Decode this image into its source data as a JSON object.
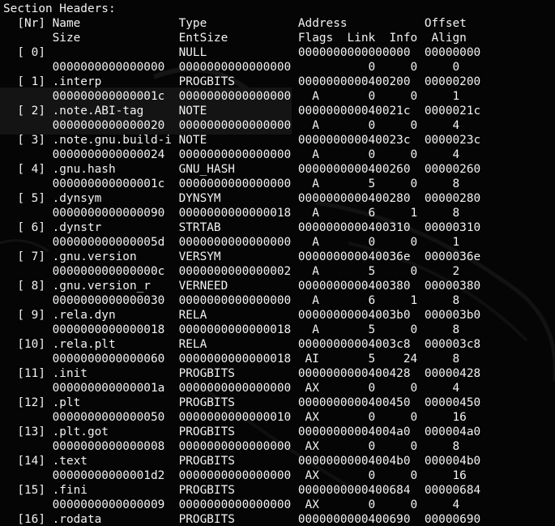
{
  "terminal": {
    "background": "#000000",
    "text_color": "#f2f2f2",
    "header": "Section Headers:",
    "column_headers": [
      "  [Nr] Name              Type             Address           Offset",
      "       Size              EntSize          Flags  Link  Info  Align"
    ],
    "sections": [
      {
        "line1": "  [ 0]                   NULL             0000000000000000  00000000",
        "line2": "       0000000000000000  0000000000000000           0     0     0"
      },
      {
        "line1": "  [ 1] .interp           PROGBITS         0000000000400200  00000200",
        "line2": "       000000000000001c  0000000000000000   A       0     0     1"
      },
      {
        "line1": "  [ 2] .note.ABI-tag     NOTE             000000000040021c  0000021c",
        "line2": "       0000000000000020  0000000000000000   A       0     0     4"
      },
      {
        "line1": "  [ 3] .note.gnu.build-i NOTE             000000000040023c  0000023c",
        "line2": "       0000000000000024  0000000000000000   A       0     0     4"
      },
      {
        "line1": "  [ 4] .gnu.hash         GNU_HASH         0000000000400260  00000260",
        "line2": "       000000000000001c  0000000000000000   A       5     0     8"
      },
      {
        "line1": "  [ 5] .dynsym           DYNSYM           0000000000400280  00000280",
        "line2": "       0000000000000090  0000000000000018   A       6     1     8"
      },
      {
        "line1": "  [ 6] .dynstr           STRTAB           0000000000400310  00000310",
        "line2": "       000000000000005d  0000000000000000   A       0     0     1"
      },
      {
        "line1": "  [ 7] .gnu.version      VERSYM           000000000040036e  0000036e",
        "line2": "       000000000000000c  0000000000000002   A       5     0     2"
      },
      {
        "line1": "  [ 8] .gnu.version_r    VERNEED          0000000000400380  00000380",
        "line2": "       0000000000000030  0000000000000000   A       6     1     8"
      },
      {
        "line1": "  [ 9] .rela.dyn         RELA             00000000004003b0  000003b0",
        "line2": "       0000000000000018  0000000000000018   A       5     0     8"
      },
      {
        "line1": "  [10] .rela.plt         RELA             00000000004003c8  000003c8",
        "line2": "       0000000000000060  0000000000000018  AI       5    24     8"
      },
      {
        "line1": "  [11] .init             PROGBITS         0000000000400428  00000428",
        "line2": "       000000000000001a  0000000000000000  AX       0     0     4"
      },
      {
        "line1": "  [12] .plt              PROGBITS         0000000000400450  00000450",
        "line2": "       0000000000000050  0000000000000010  AX       0     0     16"
      },
      {
        "line1": "  [13] .plt.got          PROGBITS         00000000004004a0  000004a0",
        "line2": "       0000000000000008  0000000000000000  AX       0     0     8"
      },
      {
        "line1": "  [14] .text             PROGBITS         00000000004004b0  000004b0",
        "line2": "       00000000000001d2  0000000000000000  AX       0     0     16"
      },
      {
        "line1": "  [15] .fini             PROGBITS         0000000000400684  00000684",
        "line2": "       0000000000000009  0000000000000000  AX       0     0     4"
      },
      {
        "line1": "  [16] .rodata           PROGBITS         0000000000400690  00000690"
      }
    ]
  }
}
